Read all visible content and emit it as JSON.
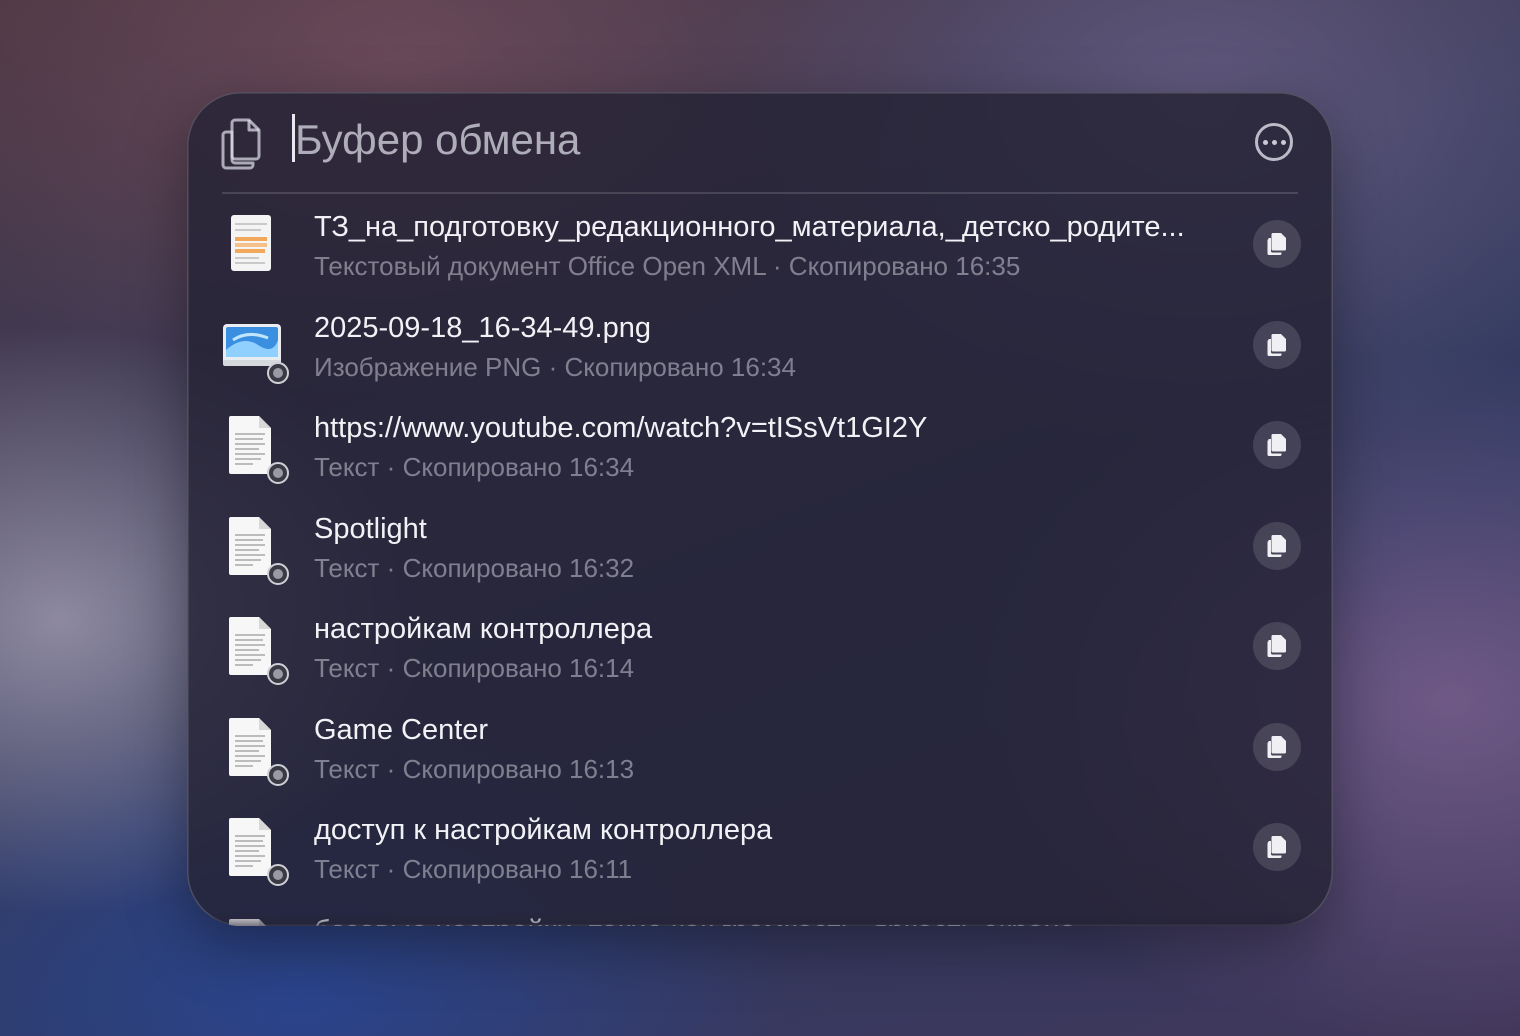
{
  "search": {
    "placeholder": "Буфер обмена",
    "value": ""
  },
  "icons": {
    "header": "clipboard-icon",
    "more": "ellipsis-circle-icon",
    "copy": "copy-icon"
  },
  "items": [
    {
      "title": "ТЗ_на_подготовку_редакционного_материала,_детско_родите...",
      "subtitle": "Текстовый документ Office Open XML · Скопировано 16:35",
      "icon": "docx-document-icon"
    },
    {
      "title": "2025-09-18_16-34-49.png",
      "subtitle": "Изображение PNG · Скопировано 16:34",
      "icon": "png-image-icon"
    },
    {
      "title": "https://www.youtube.com/watch?v=tISsVt1GI2Y",
      "subtitle": "Текст · Скопировано 16:34",
      "icon": "text-document-icon"
    },
    {
      "title": "Spotlight",
      "subtitle": "Текст · Скопировано 16:32",
      "icon": "text-document-icon"
    },
    {
      "title": "настройкам контроллера",
      "subtitle": "Текст · Скопировано 16:14",
      "icon": "text-document-icon"
    },
    {
      "title": "Game Center",
      "subtitle": "Текст · Скопировано 16:13",
      "icon": "text-document-icon"
    },
    {
      "title": "доступ к настройкам контроллера",
      "subtitle": "Текст · Скопировано 16:11",
      "icon": "text-document-icon"
    },
    {
      "title": "базовые настройки, такие как громкость, яркость экрана",
      "subtitle": "",
      "icon": "text-document-icon"
    }
  ]
}
